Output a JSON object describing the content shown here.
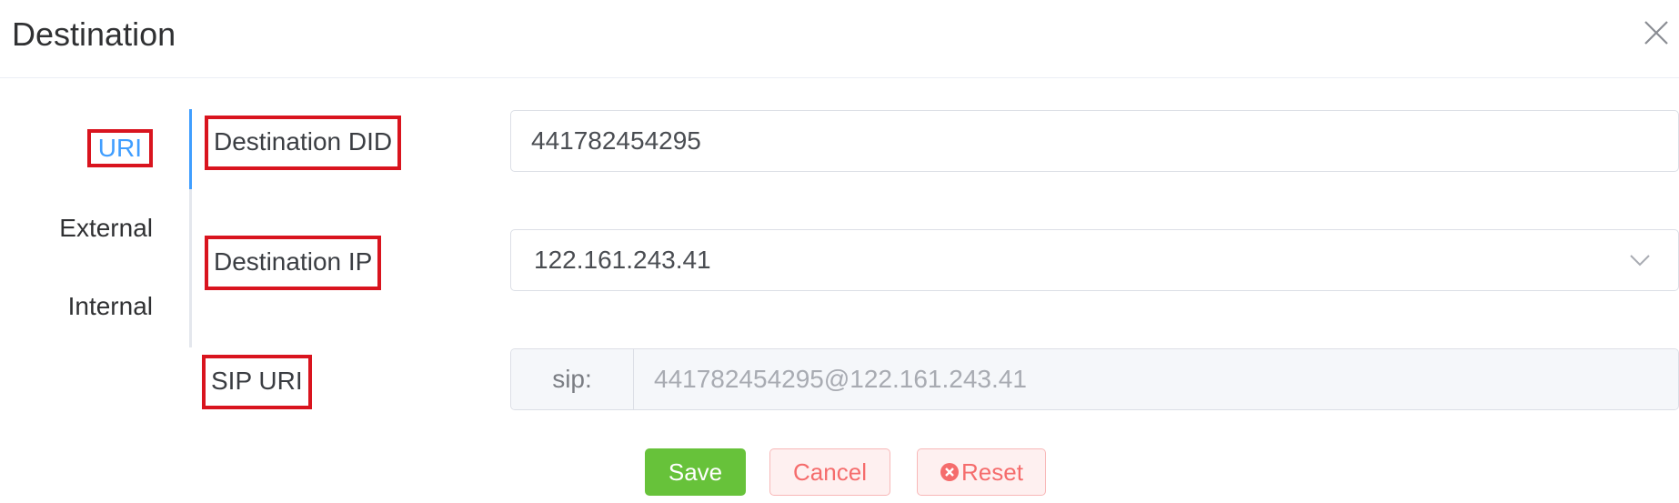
{
  "dialog": {
    "title": "Destination",
    "close_icon": "close-icon"
  },
  "tabs": {
    "items": [
      {
        "label": "URI",
        "active": true
      },
      {
        "label": "External",
        "active": false
      },
      {
        "label": "Internal",
        "active": false
      }
    ]
  },
  "form": {
    "destination_did": {
      "label": "Destination DID",
      "value": "441782454295"
    },
    "destination_ip": {
      "label": "Destination IP",
      "value": "122.161.243.41",
      "icon": "chevron-down-icon"
    },
    "sip_uri": {
      "label": "SIP URI",
      "prefix": "sip:",
      "value": "441782454295@122.161.243.41"
    }
  },
  "buttons": {
    "save": "Save",
    "cancel": "Cancel",
    "reset": "Reset",
    "reset_icon": "circle-x-icon"
  },
  "colors": {
    "accent": "#409eff",
    "success": "#67c23a",
    "danger": "#f56c6c",
    "highlight_border": "#d9141e"
  }
}
